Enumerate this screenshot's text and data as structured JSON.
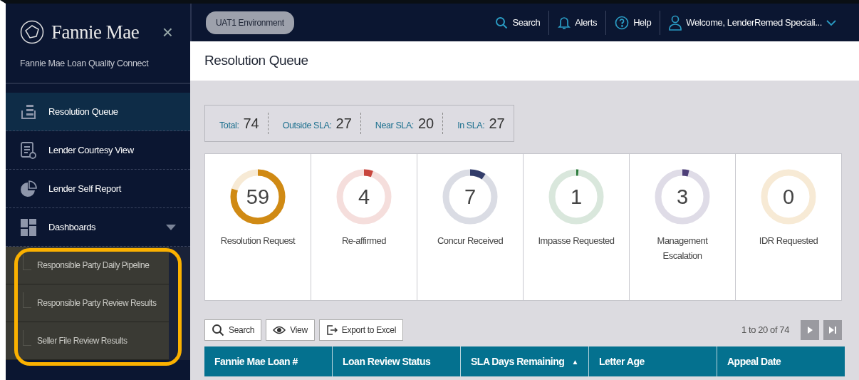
{
  "sidebar": {
    "brand": "Fannie Mae",
    "close_label": "×",
    "subtitle": "Fannie Mae Loan Quality Connect",
    "items": [
      {
        "label": "Resolution Queue",
        "selected": true
      },
      {
        "label": "Lender Courtesy View",
        "selected": false
      },
      {
        "label": "Lender Self Report",
        "selected": false
      },
      {
        "label": "Dashboards",
        "selected": false,
        "expanded": true,
        "children": [
          {
            "label": "Responsible Party Daily Pipeline"
          },
          {
            "label": "Responsible Party Review Results"
          },
          {
            "label": "Seller File Review Results"
          }
        ]
      }
    ],
    "submenu_highlighted": true
  },
  "header": {
    "environment": "UAT1 Environment",
    "links": [
      {
        "label": "Search"
      },
      {
        "label": "Alerts"
      },
      {
        "label": "Help"
      },
      {
        "label": "Welcome, LenderRemed Speciali..."
      }
    ]
  },
  "page_title": "Resolution Queue",
  "summary": [
    {
      "label": "Total:",
      "value": "74"
    },
    {
      "label": "Outside SLA:",
      "value": "27"
    },
    {
      "label": "Near SLA:",
      "value": "20"
    },
    {
      "label": "In SLA:",
      "value": "27"
    }
  ],
  "tiles": [
    {
      "count": "59",
      "label": "Resolution Request",
      "color": "#d08a14"
    },
    {
      "count": "4",
      "label": "Re-affirmed",
      "color": "#c8463d"
    },
    {
      "count": "7",
      "label": "Concur Received",
      "color": "#323c6a"
    },
    {
      "count": "1",
      "label": "Impasse Requested",
      "color": "#2a7a3a"
    },
    {
      "count": "3",
      "label": "Management Escalation",
      "color": "#4e3f78"
    },
    {
      "count": "0",
      "label": "IDR Requested"
    }
  ],
  "toolbar": [
    {
      "label": "Search"
    },
    {
      "label": "View"
    },
    {
      "label": "Export to Excel"
    }
  ],
  "pager": {
    "range": "1 to 20 of 74"
  },
  "table": {
    "columns": [
      {
        "label": "Fannie Mae Loan #"
      },
      {
        "label": "Loan Review Status"
      },
      {
        "label": "SLA Days Remaining",
        "sort_indicator": "▲"
      },
      {
        "label": "Letter Age"
      },
      {
        "label": "Appeal Date"
      }
    ]
  }
}
